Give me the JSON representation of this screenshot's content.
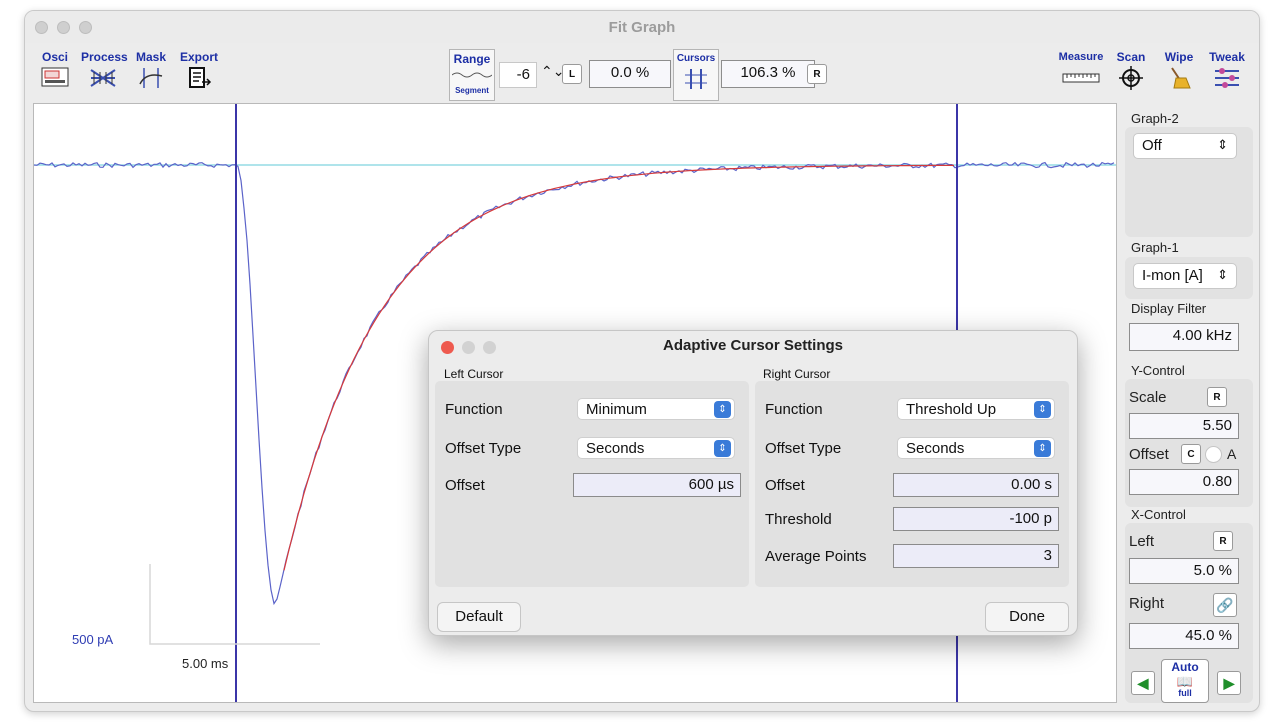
{
  "window": {
    "title": "Fit Graph"
  },
  "toolbar": {
    "osci": "Osci",
    "process": "Process",
    "mask": "Mask",
    "export": "Export",
    "range": "Range",
    "segment": "Segment",
    "range_value": "-6",
    "l_button": "L",
    "left_percent": "0.0 %",
    "cursors": "Cursors",
    "right_percent": "106.3 %",
    "r_button": "R",
    "measure": "Measure",
    "scan": "Scan",
    "wipe": "Wipe",
    "tweak": "Tweak"
  },
  "graph": {
    "scale_y": "500 pA",
    "scale_x": "5.00 ms",
    "colors": {
      "trace": "#5b63c9",
      "fit": "#d63a3a",
      "baseline": "#7fd3df",
      "cursor": "#3b35a8"
    }
  },
  "sidebar": {
    "graph2_label": "Graph-2",
    "graph2_value": "Off",
    "graph1_label": "Graph-1",
    "graph1_value": "I-mon [A]",
    "display_filter_label": "Display Filter",
    "display_filter_value": "4.00 kHz",
    "ycontrol_label": "Y-Control",
    "scale_label": "Scale",
    "scale_r": "R",
    "scale_value": "5.50",
    "offset_label": "Offset",
    "offset_c": "C",
    "offset_a": "A",
    "offset_value": "0.80",
    "xcontrol_label": "X-Control",
    "left_label": "Left",
    "left_r": "R",
    "left_value": "5.0 %",
    "right_label": "Right",
    "right_value": "45.0 %",
    "auto_label": "Auto",
    "full_label": "full"
  },
  "dialog": {
    "title": "Adaptive Cursor Settings",
    "left": {
      "header": "Left Cursor",
      "function_label": "Function",
      "function_value": "Minimum",
      "offset_type_label": "Offset Type",
      "offset_type_value": "Seconds",
      "offset_label": "Offset",
      "offset_value": "600 µs"
    },
    "right": {
      "header": "Right Cursor",
      "function_label": "Function",
      "function_value": "Threshold Up",
      "offset_type_label": "Offset Type",
      "offset_type_value": "Seconds",
      "offset_label": "Offset",
      "offset_value": "0.00 s",
      "threshold_label": "Threshold",
      "threshold_value": "-100 p",
      "avg_label": "Average Points",
      "avg_value": "3"
    },
    "default_button": "Default",
    "done_button": "Done"
  }
}
